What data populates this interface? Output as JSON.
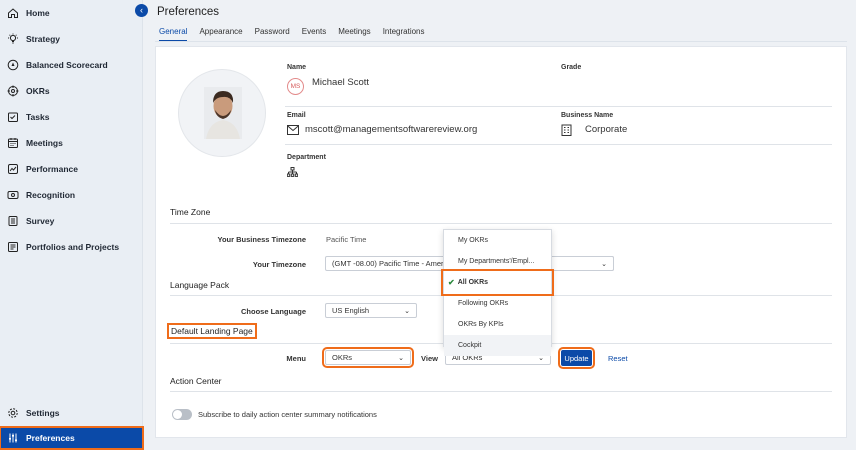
{
  "sidebar": {
    "collapse_icon": "chevron-left-icon",
    "items": [
      {
        "label": "Home",
        "icon": "home-icon"
      },
      {
        "label": "Strategy",
        "icon": "lightbulb-icon"
      },
      {
        "label": "Balanced Scorecard",
        "icon": "scorecard-icon"
      },
      {
        "label": "OKRs",
        "icon": "target-icon"
      },
      {
        "label": "Tasks",
        "icon": "tasks-icon"
      },
      {
        "label": "Meetings",
        "icon": "calendar-icon"
      },
      {
        "label": "Performance",
        "icon": "chart-icon"
      },
      {
        "label": "Recognition",
        "icon": "recognition-icon"
      },
      {
        "label": "Survey",
        "icon": "survey-icon"
      },
      {
        "label": "Portfolios and Projects",
        "icon": "portfolio-icon"
      }
    ],
    "settings": {
      "label": "Settings",
      "icon": "gear-icon"
    },
    "preferences": {
      "label": "Preferences",
      "icon": "sliders-icon"
    }
  },
  "header": {
    "title": "Preferences",
    "tabs": [
      "General",
      "Appearance",
      "Password",
      "Events",
      "Meetings",
      "Integrations"
    ],
    "active_tab": "General"
  },
  "profile": {
    "name_label": "Name",
    "initials": "MS",
    "name": "Michael Scott",
    "grade_label": "Grade",
    "email_label": "Email",
    "email": "mscott@managementsoftwarereview.org",
    "business_label": "Business Name",
    "business": "Corporate",
    "department_label": "Department"
  },
  "timezone": {
    "section_title": "Time Zone",
    "business_tz_label": "Your Business Timezone",
    "business_tz_value": "Pacific Time",
    "your_tz_label": "Your Timezone",
    "your_tz_value": "(GMT -08.00) Pacific Time - Amer"
  },
  "language": {
    "section_title": "Language Pack",
    "choose_label": "Choose Language",
    "choose_value": "US English"
  },
  "landing": {
    "section_title": "Default Landing Page",
    "menu_label": "Menu",
    "menu_value": "OKRs",
    "view_label": "View",
    "view_value": "All OKRs",
    "update_label": "Update",
    "reset_label": "Reset",
    "dropdown_options": [
      "My OKRs",
      "My Departments'/Empl...",
      "All OKRs",
      "Following OKRs",
      "OKRs By KPIs",
      "Cockpit"
    ],
    "selected_option": "All OKRs"
  },
  "action_center": {
    "section_title": "Action Center",
    "toggle_label": "Subscribe to daily action center summary notifications"
  },
  "colors": {
    "accent": "#0b4aa8",
    "highlight": "#ef6c1a",
    "check": "#2b8a3e"
  }
}
